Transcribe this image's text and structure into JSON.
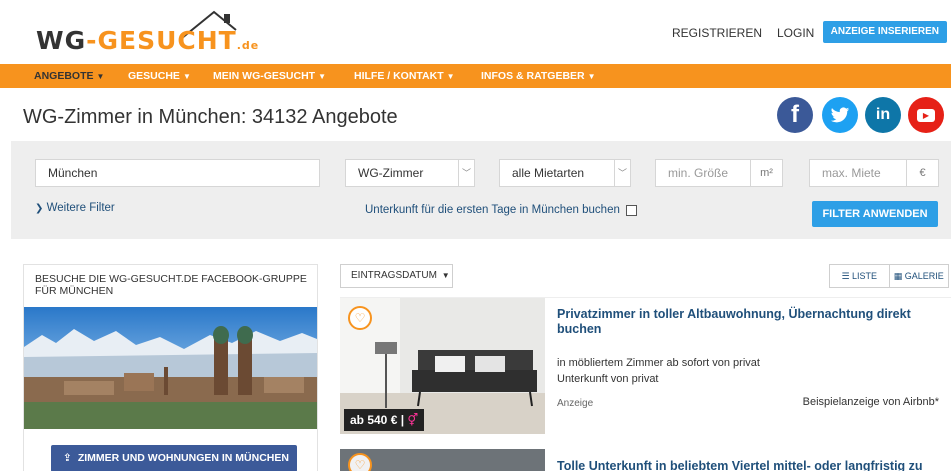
{
  "logo": {
    "part1": "WG",
    "dash": "-",
    "part2": "GESUCHT",
    "tld": ".de"
  },
  "header": {
    "register": "REGISTRIEREN",
    "login": "LOGIN",
    "insert_ad": "ANZEIGE INSERIEREN"
  },
  "nav": {
    "items": [
      {
        "label": "ANGEBOTE"
      },
      {
        "label": "GESUCHE"
      },
      {
        "label": "MEIN WG-GESUCHT"
      },
      {
        "label": "HILFE / KONTAKT"
      },
      {
        "label": "INFOS & RATGEBER"
      }
    ],
    "caret": "▼"
  },
  "page_title": "WG-Zimmer in München: 34132 Angebote",
  "social": {
    "facebook": "f",
    "twitter": "t",
    "linkedin": "in",
    "youtube": "▶"
  },
  "filters": {
    "city_value": "München",
    "category_value": "WG-Zimmer",
    "rent_type_value": "alle Mietarten",
    "min_size_placeholder": "min. Größe",
    "size_unit": "m²",
    "max_rent_placeholder": "max. Miete",
    "rent_unit": "€",
    "more_filters": "Weitere Filter",
    "stay_link": "Unterkunft für die ersten Tage in München buchen",
    "apply": "FILTER ANWENDEN"
  },
  "sidebar": {
    "fb_group_title": "BESUCHE DIE WG-GESUCHT.DE FACEBOOK-GRUPPE FÜR MÜNCHEN",
    "rooms_button": "ZIMMER UND WOHNUNGEN IN MÜNCHEN"
  },
  "results": {
    "sort_label": "EINTRAGSDATUM",
    "view_list": "LISTE",
    "view_gallery": "GALERIE",
    "listings": [
      {
        "title": "Privatzimmer in toller Altbauwohnung, Übernachtung direkt buchen",
        "description": "in möbliertem Zimmer ab sofort von privat",
        "subtitle": "Unterkunft von privat",
        "ad_label": "Anzeige",
        "example_label": "Beispielanzeige von Airbnb*",
        "price": "ab 540 € |"
      },
      {
        "title": "Tolle Unterkunft in beliebtem Viertel mittel- oder langfristig zu"
      }
    ]
  },
  "colors": {
    "brand_orange": "#f7931e",
    "button_blue": "#2e9fe6",
    "facebook_blue": "#3c5a99",
    "link_blue": "#1f4f7a"
  }
}
